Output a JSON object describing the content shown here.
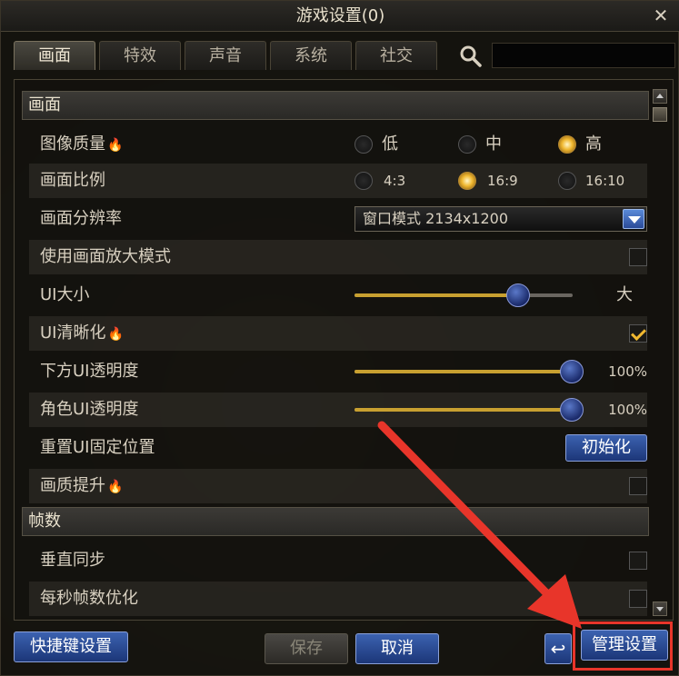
{
  "window": {
    "title": "游戏设置(0)",
    "close_icon": "close-icon"
  },
  "tabs": [
    {
      "label": "画面",
      "active": true
    },
    {
      "label": "特效",
      "active": false
    },
    {
      "label": "声音",
      "active": false
    },
    {
      "label": "系统",
      "active": false
    },
    {
      "label": "社交",
      "active": false
    }
  ],
  "search": {
    "value": "",
    "placeholder": ""
  },
  "sections": {
    "display": "画面",
    "fps": "帧数"
  },
  "rows": {
    "image_quality": {
      "label": "图像质量",
      "options": [
        "低",
        "中",
        "高"
      ],
      "selected": "高"
    },
    "aspect_ratio": {
      "label": "画面比例",
      "options": [
        "4:3",
        "16:9",
        "16:10"
      ],
      "selected": "16:9"
    },
    "resolution": {
      "label": "画面分辨率",
      "value": "窗口模式 2134x1200"
    },
    "zoom_mode": {
      "label": "使用画面放大模式",
      "checked": false
    },
    "ui_size": {
      "label": "UI大小",
      "value_label": "大",
      "level": 0.75
    },
    "ui_sharpen": {
      "label": "UI清晰化",
      "checked": true
    },
    "bottom_ui_opacity": {
      "label": "下方UI透明度",
      "value": "100%",
      "level": 1.0
    },
    "char_ui_opacity": {
      "label": "角色UI透明度",
      "value": "100%",
      "level": 1.0
    },
    "reset_ui": {
      "label": "重置UI固定位置",
      "button": "初始化"
    },
    "quality_boost": {
      "label": "画质提升",
      "checked": false
    },
    "vsync": {
      "label": "垂直同步",
      "checked": false
    },
    "fps_opt": {
      "label": "每秒帧数优化",
      "checked": false
    }
  },
  "footer": {
    "hotkey": "快捷键设置",
    "save": "保存",
    "cancel": "取消",
    "manage": "管理设置"
  },
  "colors": {
    "accent_gold": "#f0b830",
    "button_blue": "#2c4c98",
    "highlight_red": "#e8352a"
  }
}
